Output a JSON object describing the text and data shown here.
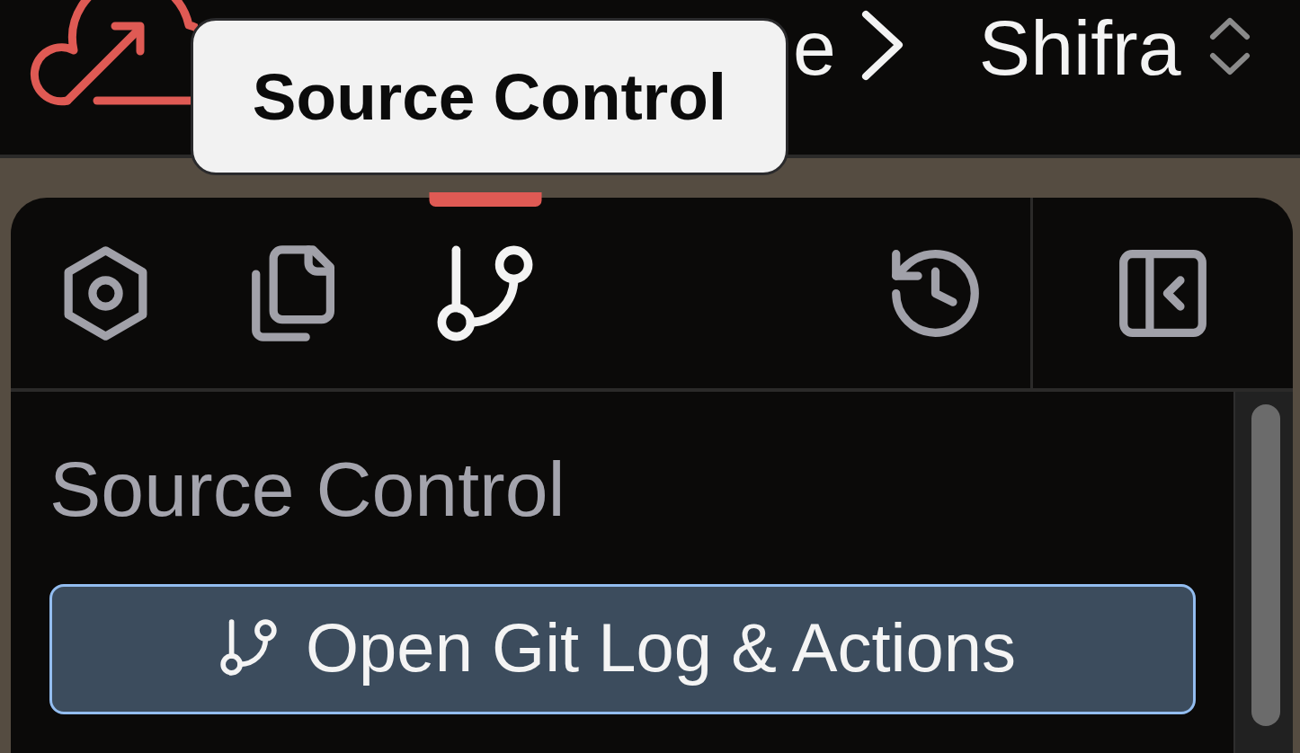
{
  "header": {
    "breadcrumb": [
      {
        "text": "e"
      },
      {
        "text": "Shifra"
      }
    ]
  },
  "tooltip": {
    "text": "Source Control"
  },
  "tabs": [
    {
      "selected": false
    },
    {
      "selected": false
    },
    {
      "selected": true
    }
  ],
  "panel": {
    "title": "Source Control",
    "button": {
      "label": "Open Git Log & Actions"
    }
  }
}
